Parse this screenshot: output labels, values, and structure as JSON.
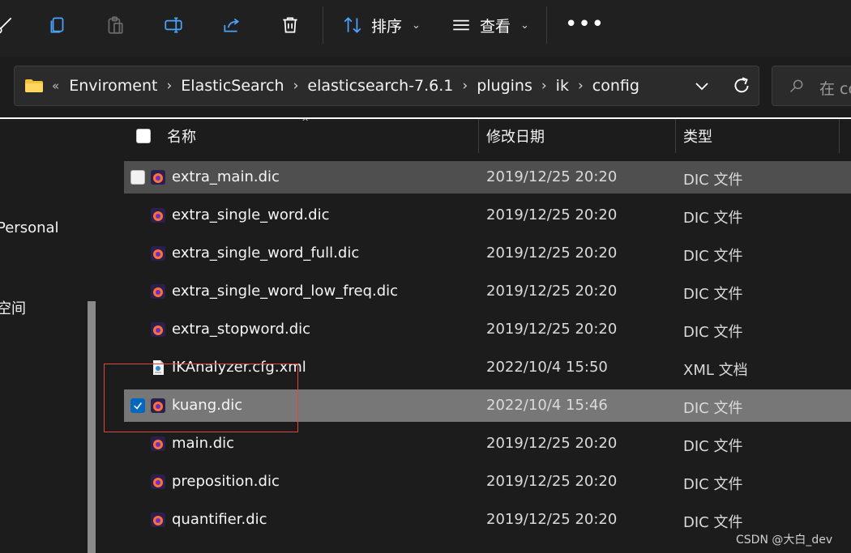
{
  "toolbar": {
    "sort_label": "排序",
    "view_label": "查看",
    "more_label": "•••"
  },
  "address": {
    "overflow": "«",
    "crumbs": [
      "Enviroment",
      "ElasticSearch",
      "elasticsearch-7.6.1",
      "plugins",
      "ik",
      "config"
    ]
  },
  "search": {
    "placeholder": "在 co"
  },
  "sidebar": {
    "items": [
      {
        "label": "Personal"
      },
      {
        "label": "空间"
      }
    ]
  },
  "table": {
    "headers": {
      "name": "名称",
      "modified": "修改日期",
      "type": "类型"
    },
    "rows": [
      {
        "name": "extra_main.dic",
        "modified": "2019/12/25 20:20",
        "type": "DIC 文件"
      },
      {
        "name": "extra_single_word.dic",
        "modified": "2019/12/25 20:20",
        "type": "DIC 文件"
      },
      {
        "name": "extra_single_word_full.dic",
        "modified": "2019/12/25 20:20",
        "type": "DIC 文件"
      },
      {
        "name": "extra_single_word_low_freq.dic",
        "modified": "2019/12/25 20:20",
        "type": "DIC 文件"
      },
      {
        "name": "extra_stopword.dic",
        "modified": "2019/12/25 20:20",
        "type": "DIC 文件"
      },
      {
        "name": "IKAnalyzer.cfg.xml",
        "modified": "2022/10/4 15:50",
        "type": "XML 文档"
      },
      {
        "name": "kuang.dic",
        "modified": "2022/10/4 15:46",
        "type": "DIC 文件"
      },
      {
        "name": "main.dic",
        "modified": "2019/12/25 20:20",
        "type": "DIC 文件"
      },
      {
        "name": "preposition.dic",
        "modified": "2019/12/25 20:20",
        "type": "DIC 文件"
      },
      {
        "name": "quantifier.dic",
        "modified": "2019/12/25 20:20",
        "type": "DIC 文件"
      }
    ]
  },
  "watermark": "CSDN @大白_dev",
  "colors": {
    "accent": "#0067c0",
    "highlight_box": "#e0463a",
    "selected_row": "#777777",
    "hover_row": "#4f4f4f"
  }
}
